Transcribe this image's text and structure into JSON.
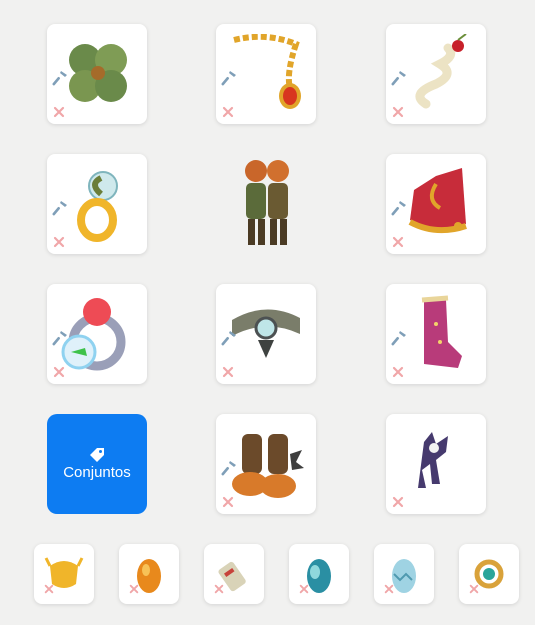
{
  "colors": {
    "background": "#f1f1f0",
    "slot": "#ffffff",
    "accent": "#0d7cf2",
    "hammer": "#7f9fb8",
    "remove": "#f0a6a8"
  },
  "sets_button": {
    "label": "Conjuntos",
    "icon": "tag-icon"
  },
  "slots": [
    {
      "item": "clover-shield-icon"
    },
    {
      "item": "gold-amulet-icon"
    },
    {
      "item": "cherry-swirl-hat-icon"
    },
    {
      "item": "golden-ring-icon"
    },
    {
      "item": "character-preview"
    },
    {
      "item": "red-gold-crown-icon"
    },
    {
      "item": "red-orb-ring-icon"
    },
    {
      "item": "mechanical-belt-icon"
    },
    {
      "item": "pink-boots-icon"
    },
    {
      "item": "steampunk-boots-icon"
    },
    {
      "item": "pet-figure-icon"
    }
  ],
  "bottom_slots": [
    {
      "item": "golden-helmet-icon"
    },
    {
      "item": "amber-egg-icon"
    },
    {
      "item": "bandage-scroll-icon"
    },
    {
      "item": "teal-egg-icon"
    },
    {
      "item": "pale-blue-egg-icon"
    },
    {
      "item": "jade-ring-icon"
    }
  ]
}
